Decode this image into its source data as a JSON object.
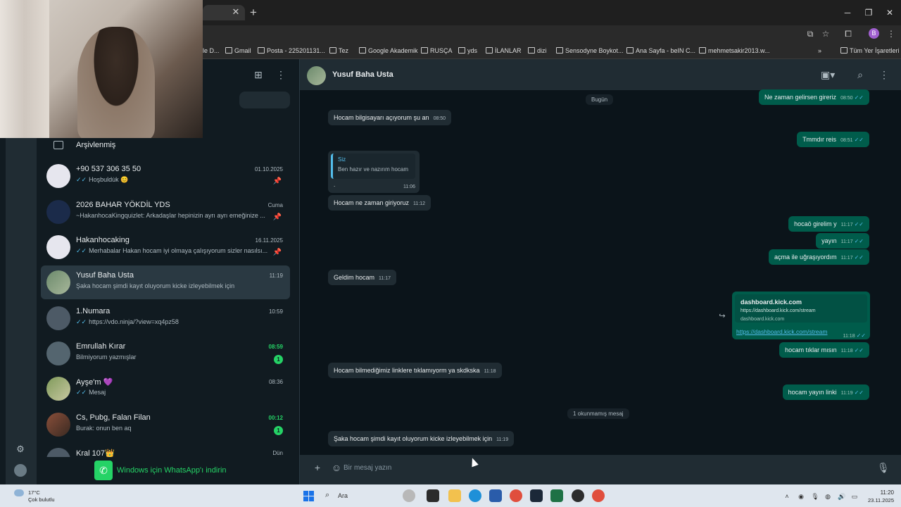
{
  "browser": {
    "bookmarks": [
      "le D...",
      "Gmail",
      "Posta - 225201131...",
      "Tez",
      "Google Akademik",
      "RUSÇA",
      "yds",
      "İLANLAR",
      "dizi",
      "Sensodyne Boykot...",
      "Ana Sayfa - beIN C...",
      "mehmetsakir2013.w..."
    ],
    "all_bookmarks": "Tüm Yer İşaretleri",
    "profile_initial": "B",
    "more": "»"
  },
  "sidebar": {
    "archived_label": "Arşivlenmiş",
    "chats": [
      {
        "name": "+90 537 306 35 50",
        "preview": "Hoşbuldu̇k 😊",
        "time": "01.10.2025",
        "pinned": true,
        "tick": true
      },
      {
        "name": "2026 BAHAR YÖKDİL YDS",
        "preview": "~HakanhocaKingquizlet: Arkadaşlar hepinizin ayrı ayrı emeğinize ...",
        "time": "Cuma",
        "pinned": true,
        "tick": false
      },
      {
        "name": "Hakanhocaking",
        "preview": "Merhabalar Hakan hocam iyi olmaya çalışıyorum sizler nasılsı...",
        "time": "16.11.2025",
        "pinned": true,
        "tick": true
      },
      {
        "name": "Yusuf Baha Usta",
        "preview": "Şaka hocam şimdi kayıt oluyorum kicke izleyebilmek için",
        "time": "11:19",
        "pinned": false,
        "tick": false
      },
      {
        "name": "1.Numara",
        "preview": "https://vdo.ninja/?view=xq4pz58",
        "time": "10:59",
        "pinned": false,
        "tick": true
      },
      {
        "name": "Emrullah Kırar",
        "preview": "Bilmiyorum yazmışlar",
        "time": "08:59",
        "badge": "1",
        "pinned": false,
        "tick": false
      },
      {
        "name": "Ayşe'm 💜",
        "preview": "Mesaj",
        "time": "08:36",
        "pinned": false,
        "tick": true
      },
      {
        "name": "Cs, Pubg, Falan Filan",
        "preview": "Burak: onun ben aq",
        "time": "00:12",
        "badge": "1",
        "pinned": false,
        "tick": false
      },
      {
        "name": "Kral 107👑",
        "preview": "",
        "time": "Dün",
        "pinned": false,
        "tick": false
      }
    ],
    "download_label": "Windows için WhatsApp'ı indirin"
  },
  "conversation": {
    "contact_name": "Yusuf Baha Usta",
    "day_label": "Bugün",
    "unread_label": "1 okunmamış mesaj",
    "messages": [
      {
        "dir": "out",
        "text": "Ne zaman gelirsen gireriz",
        "time": "08:50"
      },
      {
        "dir": "in",
        "text": "Hocam bilgisayarı açıyorum şu an",
        "time": "08:50"
      },
      {
        "dir": "out",
        "text": "Tmmdır reis",
        "time": "08:51"
      },
      {
        "dir": "in",
        "text": "Hocam ne zaman giriyoruz",
        "time": "11:12"
      },
      {
        "dir": "out",
        "text": "hocaö girelim y",
        "time": "11:17"
      },
      {
        "dir": "out",
        "text": "yayın",
        "time": "11:17"
      },
      {
        "dir": "out",
        "text": "açma ile uğraşıyordım",
        "time": "11:17"
      },
      {
        "dir": "in",
        "text": "Geldim hocam",
        "time": "11:17"
      },
      {
        "dir": "out",
        "text": "hocam tıklar mısın",
        "time": "11:18"
      },
      {
        "dir": "in",
        "text": "Hocam bilmediğimiz linklere tıklamıyorm ya skdkska",
        "time": "11:18"
      },
      {
        "dir": "out",
        "text": "hocam yayın linki",
        "time": "11:19"
      },
      {
        "dir": "in",
        "text": "Şaka hocam şimdi kayıt oluyorum kicke izleyebilmek için",
        "time": "11:19"
      }
    ],
    "quote": {
      "from": "Siz",
      "text": "Ben hazır ve nazırım hocam",
      "body": ".",
      "time": "11:06"
    },
    "link_card": {
      "title": "dashboard.kick.com",
      "url": "https://dashboard.kick.com/stream",
      "domain": "dashboard.kick.com",
      "link": "https://dashboard.kick.com/stream",
      "time": "11:18"
    },
    "input_placeholder": "Bir mesaj yazın"
  },
  "taskbar": {
    "temp": "17°C",
    "weather": "Çok bulutlu",
    "search": "Ara",
    "time": "11:20",
    "date": "23.11.2025"
  }
}
